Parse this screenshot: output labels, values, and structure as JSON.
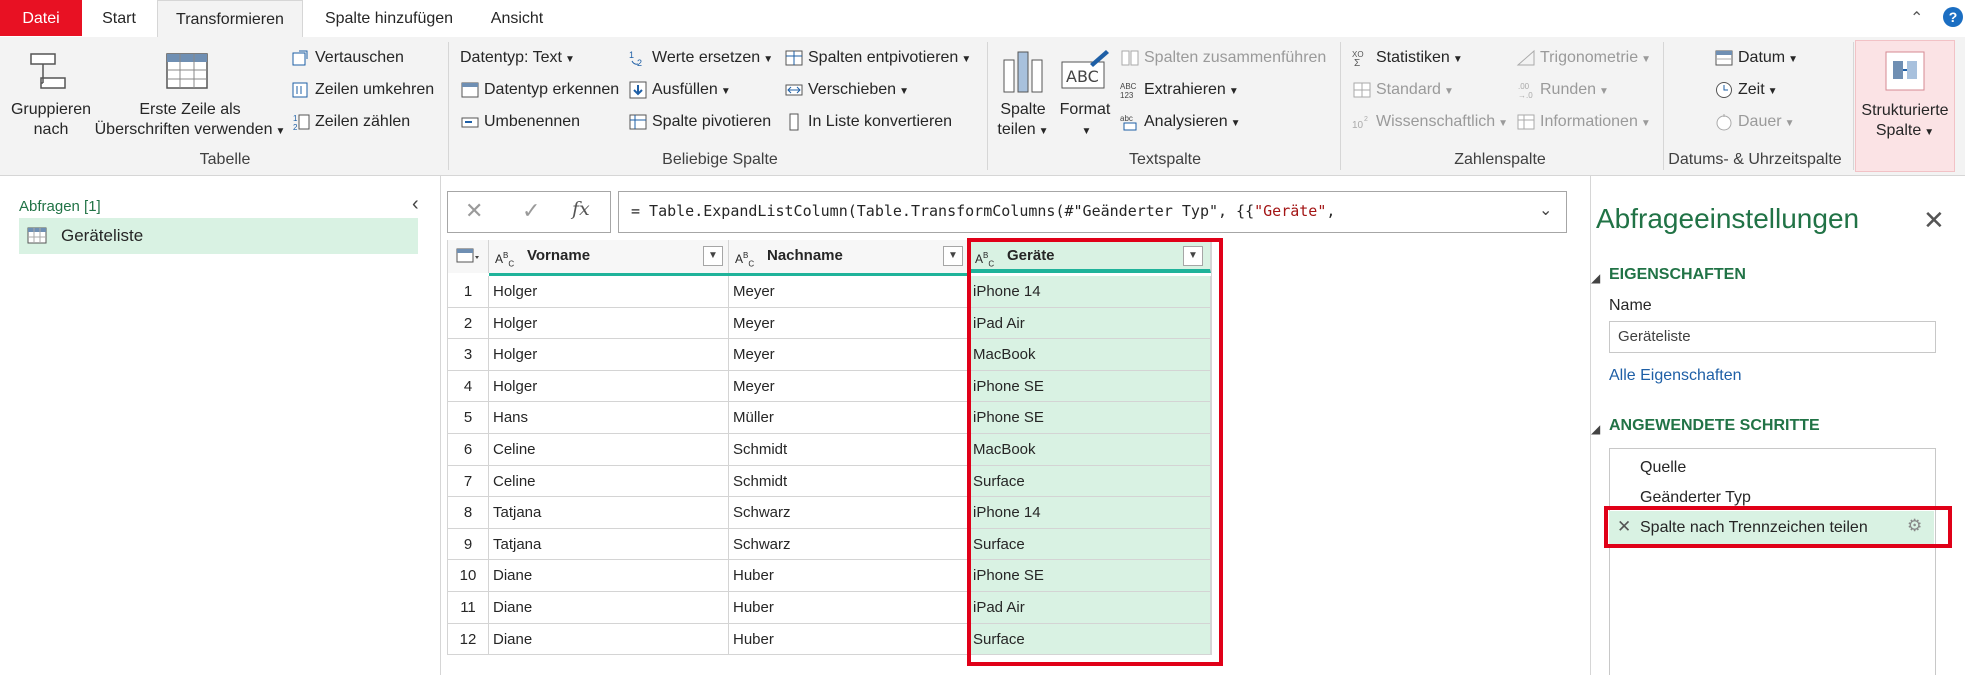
{
  "tabs": [
    "Datei",
    "Start",
    "Transformieren",
    "Spalte hinzufügen",
    "Ansicht"
  ],
  "ribbon": {
    "tabelle": {
      "title": "Tabelle",
      "gruppieren": "Gruppieren nach",
      "gruppieren_l1": "Gruppieren",
      "gruppieren_l2": "nach",
      "erste_zeile_l1": "Erste Zeile als",
      "erste_zeile_l2": "Überschriften verwenden",
      "vertauschen": "Vertauschen",
      "zeilen_umkehren": "Zeilen umkehren",
      "zeilen_zaehlen": "Zeilen zählen"
    },
    "beliebige_spalte": {
      "title": "Beliebige Spalte",
      "datentyp": "Datentyp: Text",
      "datentyp_erkennen": "Datentyp erkennen",
      "umbenennen": "Umbenennen",
      "werte_ersetzen": "Werte ersetzen",
      "ausfuellen": "Ausfüllen",
      "spalte_pivotieren": "Spalte pivotieren",
      "spalten_entpivotieren": "Spalten entpivotieren",
      "verschieben": "Verschieben",
      "in_liste": "In Liste konvertieren"
    },
    "textspalte": {
      "title": "Textspalte",
      "spalte_teilen_l1": "Spalte",
      "spalte_teilen_l2": "teilen",
      "format": "Format",
      "zusammenfuehren": "Spalten zusammenführen",
      "extrahieren": "Extrahieren",
      "analysieren": "Analysieren"
    },
    "zahlenspalte": {
      "title": "Zahlenspalte",
      "statistiken": "Statistiken",
      "standard": "Standard",
      "wissenschaftlich": "Wissenschaftlich",
      "trigonometrie": "Trigonometrie",
      "runden": "Runden",
      "informationen": "Informationen"
    },
    "datum": {
      "title": "Datums- & Uhrzeitspalte",
      "datum": "Datum",
      "zeit": "Zeit",
      "dauer": "Dauer"
    },
    "strukturiert": {
      "l1": "Strukturierte",
      "l2": "Spalte"
    }
  },
  "left": {
    "header": "Abfragen [1]",
    "query": "Geräteliste"
  },
  "formula": {
    "prefix": "= Table.ExpandListColumn(Table.TransformColumns(#\"Geänderter Typ\", {{",
    "string": "\"Geräte\"",
    "suffix": ","
  },
  "columns": [
    "Vorname",
    "Nachname",
    "Geräte"
  ],
  "rows": [
    [
      "1",
      "Holger",
      "Meyer",
      "iPhone 14"
    ],
    [
      "2",
      "Holger",
      "Meyer",
      "iPad Air"
    ],
    [
      "3",
      "Holger",
      "Meyer",
      "MacBook"
    ],
    [
      "4",
      "Holger",
      "Meyer",
      "iPhone SE"
    ],
    [
      "5",
      "Hans",
      "Müller",
      "iPhone SE"
    ],
    [
      "6",
      "Celine",
      "Schmidt",
      "MacBook"
    ],
    [
      "7",
      "Celine",
      "Schmidt",
      "Surface"
    ],
    [
      "8",
      "Tatjana",
      "Schwarz",
      "iPhone 14"
    ],
    [
      "9",
      "Tatjana",
      "Schwarz",
      "Surface"
    ],
    [
      "10",
      "Diane",
      "Huber",
      "iPhone SE"
    ],
    [
      "11",
      "Diane",
      "Huber",
      "iPad Air"
    ],
    [
      "12",
      "Diane",
      "Huber",
      "Surface"
    ]
  ],
  "right": {
    "title": "Abfrageeinstellungen",
    "eigenschaften": "EIGENSCHAFTEN",
    "name_label": "Name",
    "name_value": "Geräteliste",
    "alle_eigenschaften": "Alle Eigenschaften",
    "schritte": "ANGEWENDETE SCHRITTE",
    "steps": [
      "Quelle",
      "Geänderter Typ",
      "Spalte nach Trennzeichen teilen"
    ]
  },
  "colors": {
    "accent": "#217346",
    "highlight_border": "#e00018",
    "selected_column": "#d9f2e3",
    "file_tab": "#e81123"
  }
}
